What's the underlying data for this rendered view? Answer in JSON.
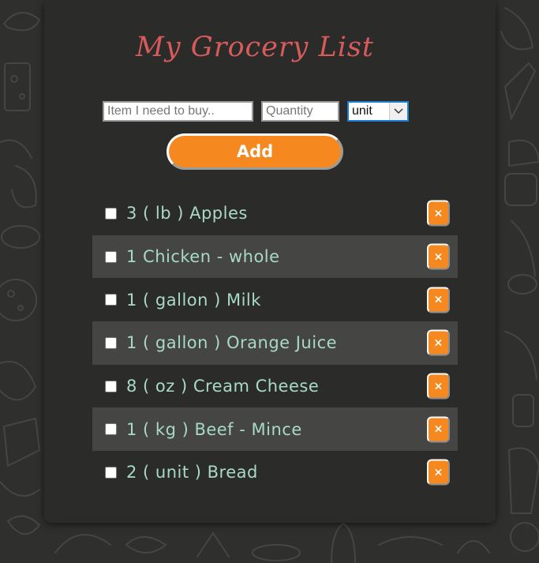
{
  "title": "My Grocery List",
  "form": {
    "item_placeholder": "Item I need to buy..",
    "quantity_placeholder": "Quantity",
    "unit_selected": "unit",
    "add_label": "Add"
  },
  "items": [
    {
      "text": "3 ( lb ) Apples",
      "checked": false
    },
    {
      "text": "1 Chicken - whole",
      "checked": false
    },
    {
      "text": "1 ( gallon ) Milk",
      "checked": false
    },
    {
      "text": "1 ( gallon ) Orange Juice",
      "checked": false
    },
    {
      "text": "8 ( oz ) Cream Cheese",
      "checked": false
    },
    {
      "text": "1 ( kg ) Beef - Mince",
      "checked": false
    },
    {
      "text": "2 ( unit ) Bread",
      "checked": false
    }
  ],
  "delete_label": "×",
  "colors": {
    "accent": "#f5891f",
    "title": "#d85b5b",
    "item_text": "#a8d9c9",
    "card_bg": "#2b2b2a",
    "row_alt_bg": "#454544"
  }
}
